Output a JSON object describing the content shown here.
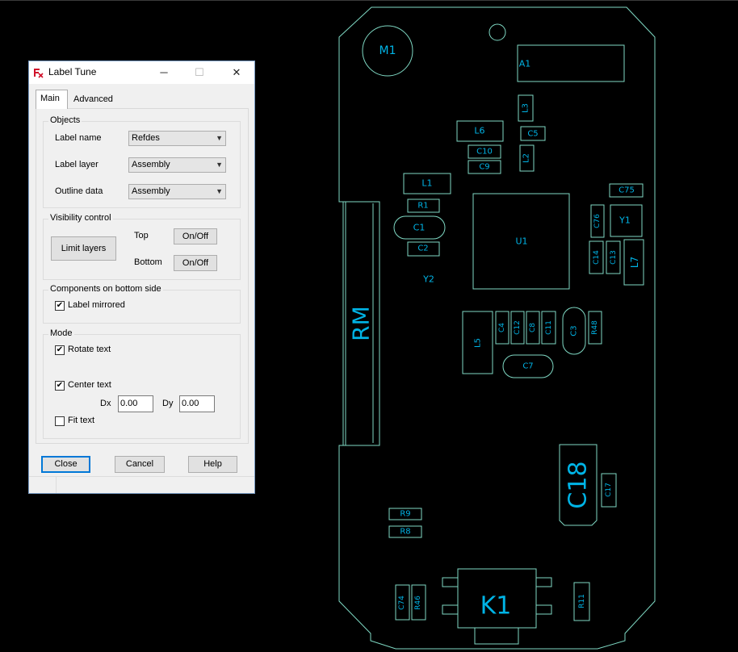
{
  "board": {
    "labels": {
      "m1": "M1",
      "a1": "A1",
      "l3": "L3",
      "l6": "L6",
      "c5": "C5",
      "c10": "C10",
      "l2": "L2",
      "c9": "C9",
      "l1": "L1",
      "c75": "C75",
      "r1": "R1",
      "c1": "C1",
      "u1": "U1",
      "c76": "C76",
      "y1": "Y1",
      "c2": "C2",
      "c14": "C14",
      "c13": "C13",
      "l7": "L7",
      "y2": "Y2",
      "rm": "RM",
      "c4": "C4",
      "c12": "C12",
      "c8": "C8",
      "c11": "C11",
      "c3": "C3",
      "r48": "R48",
      "l5": "L5",
      "c7": "C7",
      "c18": "C18",
      "c17": "C17",
      "r9": "R9",
      "r8": "R8",
      "c74": "C74",
      "r46": "R46",
      "k1": "K1",
      "r11": "R11"
    },
    "colors": {
      "outline": "#7fd9c4",
      "label": "#00b4e6",
      "background": "#000000"
    }
  },
  "dialog": {
    "title": "Label Tune",
    "window_buttons": {
      "minimize": "─",
      "maximize": "☐",
      "close": "✕"
    },
    "tabs": [
      "Main",
      "Advanced"
    ],
    "objects": {
      "group_title": "Objects",
      "label_name": {
        "label": "Label name",
        "value": "Refdes"
      },
      "label_layer": {
        "label": "Label layer",
        "value": "Assembly"
      },
      "outline_data": {
        "label": "Outline data",
        "value": "Assembly"
      }
    },
    "visibility": {
      "group_title": "Visibility control",
      "limit_layers": "Limit layers",
      "top_label": "Top",
      "top_button": "On/Off",
      "bottom_label": "Bottom",
      "bottom_button": "On/Off"
    },
    "bottom_side": {
      "group_title": "Components on bottom side",
      "label_mirrored": {
        "label": "Label mirrored",
        "checked": true
      }
    },
    "mode": {
      "group_title": "Mode",
      "rotate_text": {
        "label": "Rotate text",
        "checked": true
      },
      "center_text": {
        "label": "Center text",
        "checked": true
      },
      "dx_label": "Dx",
      "dx_value": "0.00",
      "dy_label": "Dy",
      "dy_value": "0.00",
      "fit_text": {
        "label": "Fit text",
        "checked": false
      }
    },
    "buttons": {
      "close": "Close",
      "cancel": "Cancel",
      "help": "Help"
    }
  }
}
